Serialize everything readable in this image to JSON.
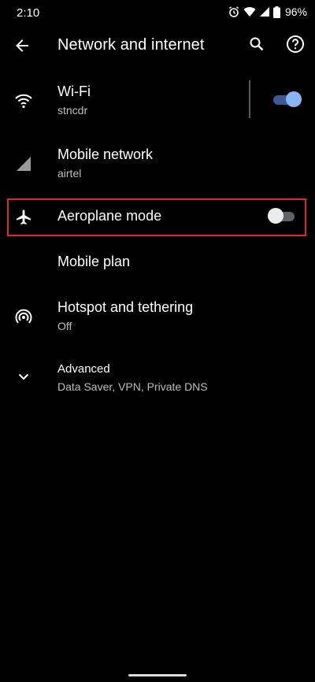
{
  "status_bar": {
    "time": "2:10",
    "battery": "96%",
    "icons": [
      "alarm-icon",
      "wifi-icon",
      "signal-icon",
      "battery-icon"
    ]
  },
  "header": {
    "title": "Network and internet",
    "back_icon": "arrow-left-icon",
    "search_icon": "search-icon",
    "help_icon": "help-icon"
  },
  "settings": {
    "wifi": {
      "title": "Wi-Fi",
      "subtitle": "stncdr",
      "toggle": true
    },
    "mobile_network": {
      "title": "Mobile network",
      "subtitle": "airtel"
    },
    "aeroplane": {
      "title": "Aeroplane mode",
      "toggle": false
    },
    "mobile_plan": {
      "title": "Mobile plan"
    },
    "hotspot": {
      "title": "Hotspot and tethering",
      "subtitle": "Off"
    },
    "advanced": {
      "title": "Advanced",
      "subtitle": "Data Saver, VPN, Private DNS"
    }
  },
  "colors": {
    "background": "#000000",
    "accent": "#8ab4f8",
    "highlight": "#d92b2b"
  }
}
